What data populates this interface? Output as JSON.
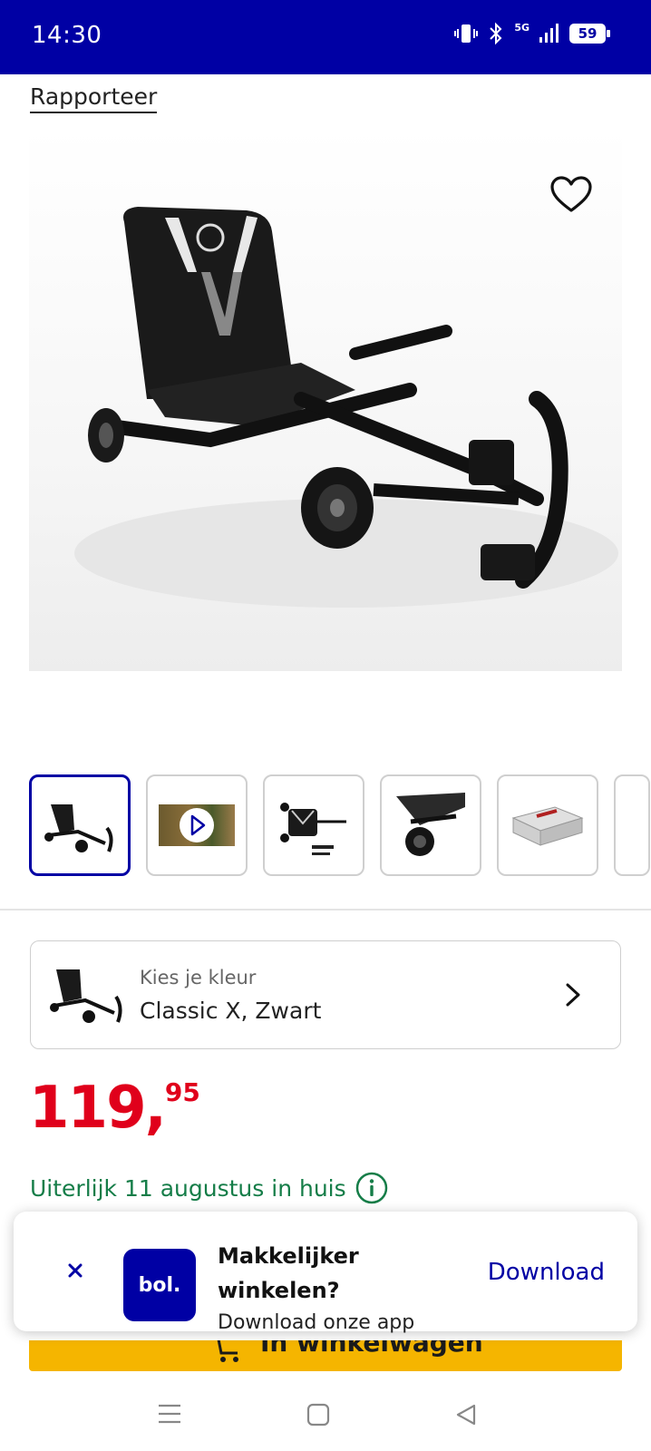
{
  "status_bar": {
    "time": "14:30",
    "network": "5G",
    "battery": "59"
  },
  "report_link": "Rapporteer",
  "product": {
    "image_icons": [
      "heart-icon"
    ],
    "thumbnails": [
      {
        "name": "thumbnail-1",
        "active": true
      },
      {
        "name": "thumbnail-2-video",
        "active": false
      },
      {
        "name": "thumbnail-3",
        "active": false
      },
      {
        "name": "thumbnail-4",
        "active": false
      },
      {
        "name": "thumbnail-5",
        "active": false
      }
    ]
  },
  "color_selector": {
    "label": "Kies je kleur",
    "value": "Classic X, Zwart"
  },
  "price": {
    "whole": "119,",
    "fraction": "95",
    "color": "#e0001b"
  },
  "delivery": {
    "text": "Uiterlijk 11 augustus in huis",
    "color": "#157d48"
  },
  "cart_button": {
    "label": "In winkelwagen",
    "color": "#f5b500"
  },
  "app_banner": {
    "logo_text": "bol.",
    "title": "Makkelijker winkelen?",
    "subtitle": "Download onze app",
    "download_label": "Download",
    "brand_color": "#0000a4"
  }
}
